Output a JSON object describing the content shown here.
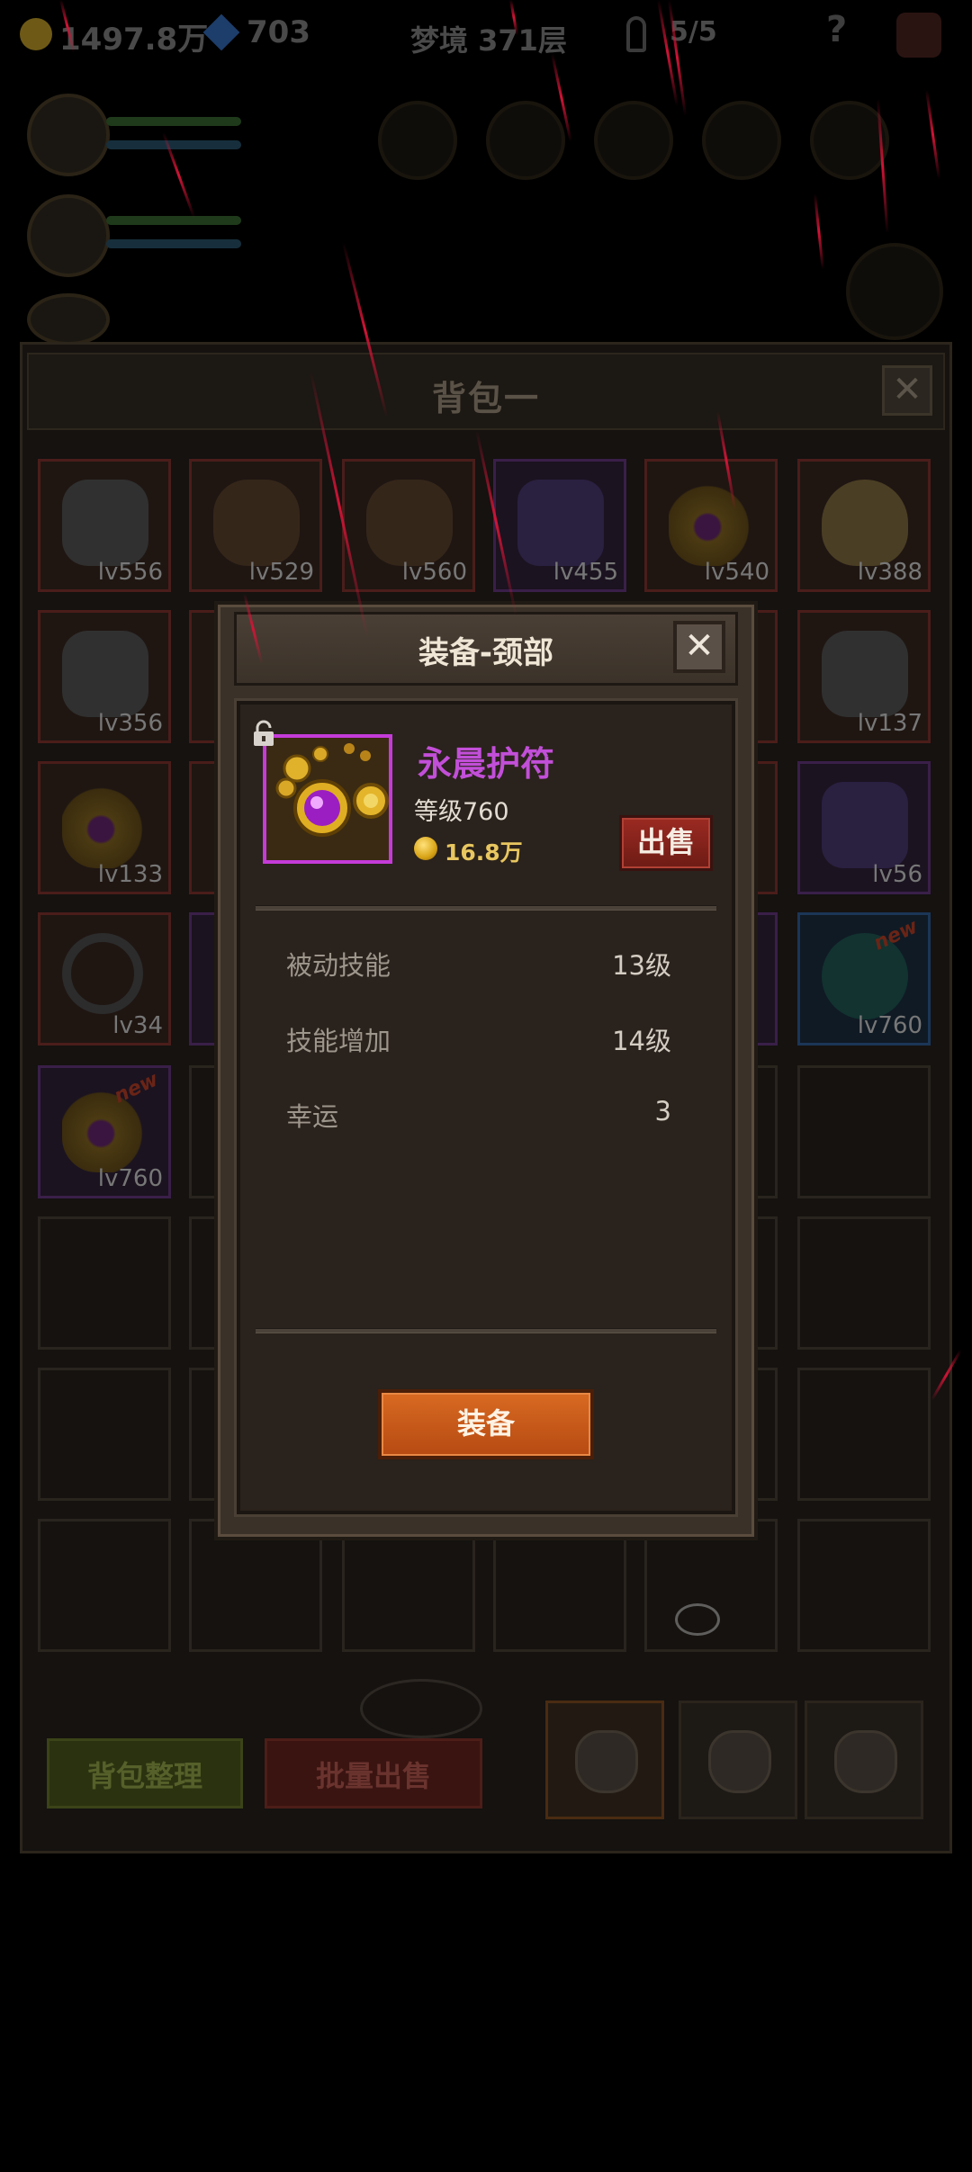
{
  "hud": {
    "gold": "1497.8万",
    "gems": "703",
    "floor": "梦境 371层",
    "keys": "5/5",
    "help_icon": "question-icon"
  },
  "bag": {
    "title": "背包一",
    "close_icon": "close-icon",
    "slots": [
      {
        "lv": "lv556",
        "tier": "red",
        "art": "steel"
      },
      {
        "lv": "lv529",
        "tier": "red",
        "art": "brown"
      },
      {
        "lv": "lv560",
        "tier": "red",
        "art": "brown"
      },
      {
        "lv": "lv455",
        "tier": "purple",
        "art": "violet"
      },
      {
        "lv": "lv540",
        "tier": "red",
        "art": "gold"
      },
      {
        "lv": "lv388",
        "tier": "red",
        "art": "skull"
      },
      {
        "lv": "lv356",
        "tier": "red",
        "art": "steel"
      },
      {
        "lv": "lv137",
        "tier": "red",
        "art": "steel"
      },
      {
        "lv": "lv133",
        "tier": "red",
        "art": "gold"
      },
      {
        "lv": "lv56",
        "tier": "purple",
        "art": "violet"
      },
      {
        "lv": "lv34",
        "tier": "red",
        "art": "ring"
      },
      {
        "lv": "lv760",
        "tier": "blue",
        "art": "globe",
        "tag": "new"
      },
      {
        "lv": "lv760",
        "tier": "purple",
        "art": "gold",
        "tag": "new"
      }
    ],
    "sort_label": "背包整理",
    "bulk_sell_label": "批量出售"
  },
  "modal": {
    "title": "装备-颈部",
    "close_icon": "close-icon",
    "item": {
      "name": "永晨护符",
      "level": "等级760",
      "price": "16.8万",
      "rarity_color": "#c24fd8"
    },
    "sell_label": "出售",
    "stats": [
      {
        "label": "被动技能",
        "value": "13级"
      },
      {
        "label": "技能增加",
        "value": "14级"
      },
      {
        "label": "幸运",
        "value": "3"
      }
    ],
    "equip_label": "装备"
  },
  "colors": {
    "equip_button": "#c9581a",
    "sell_button": "#8a2520",
    "item_name": "#c24fd8"
  }
}
